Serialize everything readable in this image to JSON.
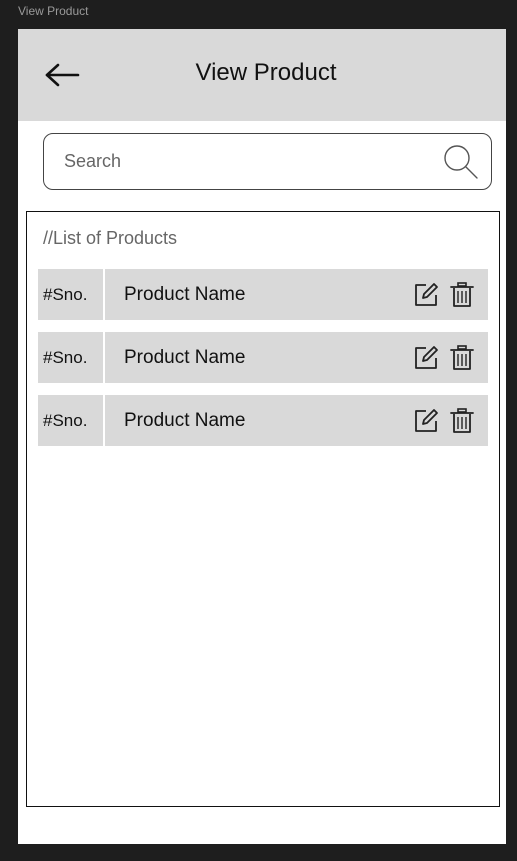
{
  "window": {
    "frame_label": "View Product"
  },
  "header": {
    "title": "View Product",
    "back_icon": "arrow-left-icon"
  },
  "search": {
    "placeholder": "Search",
    "value": "",
    "icon": "search-icon"
  },
  "list": {
    "caption": "//List of Products",
    "rows": [
      {
        "sno": "#Sno.",
        "name": "Product Name",
        "edit_icon": "edit-icon",
        "delete_icon": "trash-icon"
      },
      {
        "sno": "#Sno.",
        "name": "Product Name",
        "edit_icon": "edit-icon",
        "delete_icon": "trash-icon"
      },
      {
        "sno": "#Sno.",
        "name": "Product Name",
        "edit_icon": "edit-icon",
        "delete_icon": "trash-icon"
      }
    ]
  },
  "colors": {
    "app_background": "#1e1e1e",
    "header_background": "#d9d9d9",
    "row_background": "#d9d9d9",
    "screen_background": "#ffffff"
  }
}
